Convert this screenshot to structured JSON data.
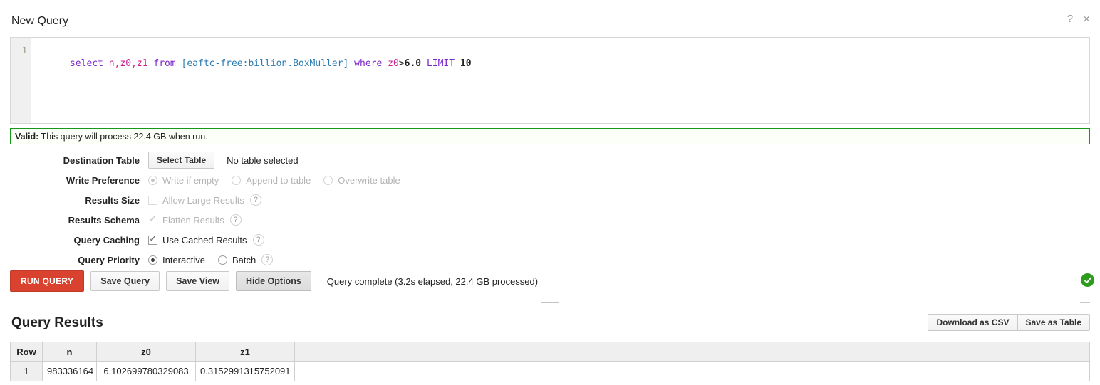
{
  "header": {
    "title": "New Query",
    "help_icon": "?",
    "close_icon": "×"
  },
  "editor": {
    "line_number": "1",
    "query_tokens": [
      {
        "text": "select",
        "type": "keyword"
      },
      {
        "text": " ",
        "type": "plain"
      },
      {
        "text": "n,z0,z1",
        "type": "identifier"
      },
      {
        "text": " ",
        "type": "plain"
      },
      {
        "text": "from",
        "type": "keyword"
      },
      {
        "text": " ",
        "type": "plain"
      },
      {
        "text": "[eaftc-free:billion.BoxMuller]",
        "type": "bracket"
      },
      {
        "text": " ",
        "type": "plain"
      },
      {
        "text": "where",
        "type": "keyword"
      },
      {
        "text": " ",
        "type": "plain"
      },
      {
        "text": "z0",
        "type": "identifier"
      },
      {
        "text": ">",
        "type": "operator"
      },
      {
        "text": "6.0",
        "type": "number"
      },
      {
        "text": " ",
        "type": "plain"
      },
      {
        "text": "LIMIT",
        "type": "keyword"
      },
      {
        "text": " ",
        "type": "plain"
      },
      {
        "text": "10",
        "type": "number"
      }
    ],
    "query_text": "select n,z0,z1 from [eaftc-free:billion.BoxMuller] where z0>6.0 LIMIT 10"
  },
  "validation": {
    "label": "Valid:",
    "message": "This query will process 22.4 GB when run.",
    "border_color": "#14991a"
  },
  "options": {
    "destination_table": {
      "label": "Destination Table",
      "button_label": "Select Table",
      "value": "No table selected"
    },
    "write_preference": {
      "label": "Write Preference",
      "disabled": true,
      "choices": [
        {
          "label": "Write if empty",
          "selected": true
        },
        {
          "label": "Append to table",
          "selected": false
        },
        {
          "label": "Overwrite table",
          "selected": false
        }
      ]
    },
    "results_size": {
      "label": "Results Size",
      "disabled": true,
      "checkbox_label": "Allow Large Results",
      "checked": false,
      "help": "?"
    },
    "results_schema": {
      "label": "Results Schema",
      "disabled": true,
      "checkbox_label": "Flatten Results",
      "checked": true,
      "help": "?"
    },
    "query_caching": {
      "label": "Query Caching",
      "disabled": false,
      "checkbox_label": "Use Cached Results",
      "checked": true,
      "help": "?"
    },
    "query_priority": {
      "label": "Query Priority",
      "disabled": false,
      "help": "?",
      "choices": [
        {
          "label": "Interactive",
          "selected": true
        },
        {
          "label": "Batch",
          "selected": false
        }
      ]
    }
  },
  "actions": {
    "run_label": "RUN QUERY",
    "save_query_label": "Save Query",
    "save_view_label": "Save View",
    "hide_options_label": "Hide Options",
    "status": "Query complete (3.2s elapsed, 22.4 GB processed)",
    "success_icon": "✓",
    "accent_color": "#d9422e",
    "success_color": "#2f9c20"
  },
  "results": {
    "title": "Query Results",
    "download_csv_label": "Download as CSV",
    "save_table_label": "Save as Table",
    "columns": [
      "Row",
      "n",
      "z0",
      "z1"
    ],
    "rows": [
      {
        "row": "1",
        "n": "983336164",
        "z0": "6.102699780329083",
        "z1": "0.3152991315752091"
      }
    ]
  }
}
